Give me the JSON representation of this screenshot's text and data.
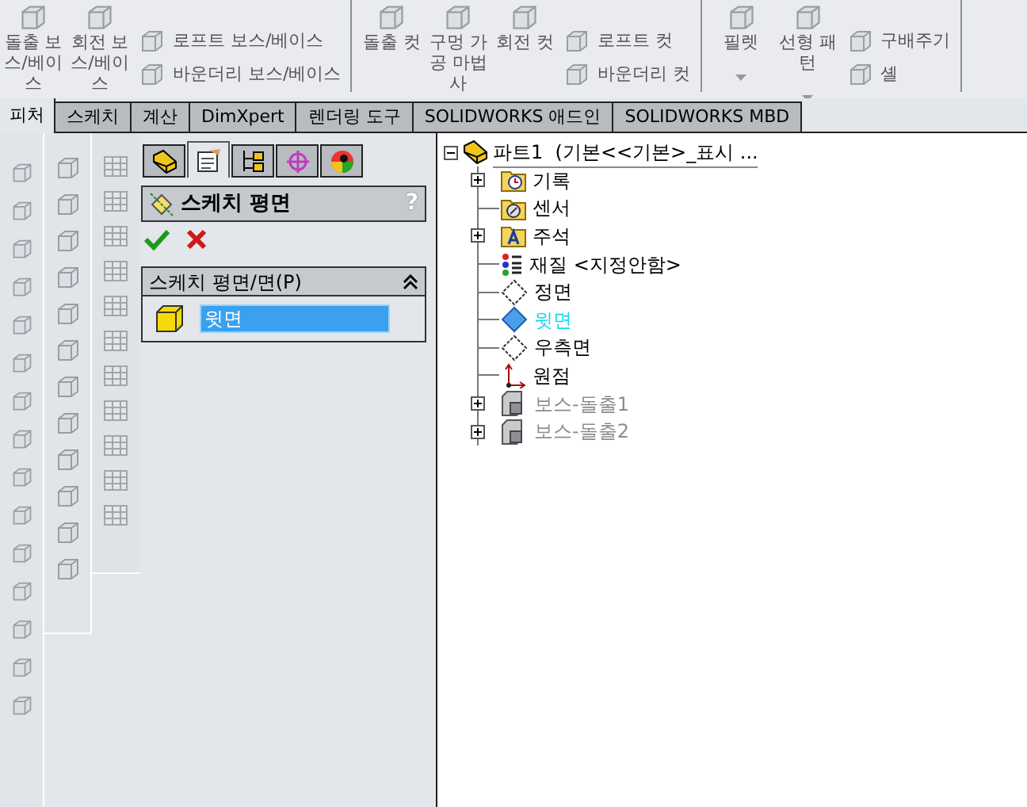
{
  "ribbon": {
    "groups": [
      {
        "large_buttons": [
          {
            "label": "돌출 보스/베이스",
            "dropdown": false
          },
          {
            "label": "회전 보스/베이스",
            "dropdown": false
          }
        ],
        "small_buttons": [
          "로프트 보스/베이스",
          "바운더리 보스/베이스"
        ]
      },
      {
        "large_buttons": [
          {
            "label": "돌출 컷",
            "dropdown": false
          },
          {
            "label": "구멍 가공 마법사",
            "dropdown": false
          },
          {
            "label": "회전 컷",
            "dropdown": false
          }
        ],
        "small_buttons": [
          "로프트 컷",
          "바운더리 컷"
        ]
      },
      {
        "large_buttons": [
          {
            "label": "필렛",
            "dropdown": true
          },
          {
            "label": "선형 패턴",
            "dropdown": true
          }
        ],
        "small_buttons": [
          "구배주기",
          "셸"
        ]
      }
    ]
  },
  "tabs": [
    {
      "label": "피처",
      "selected": true
    },
    {
      "label": "스케치",
      "selected": false
    },
    {
      "label": "계산",
      "selected": false
    },
    {
      "label": "DimXpert",
      "selected": false
    },
    {
      "label": "렌더링 도구",
      "selected": false
    },
    {
      "label": "SOLIDWORKS 애드인",
      "selected": false
    },
    {
      "label": "SOLIDWORKS MBD",
      "selected": false
    }
  ],
  "property_manager": {
    "tabs": [
      {
        "kind": "feature",
        "selected": false
      },
      {
        "kind": "property",
        "selected": true
      },
      {
        "kind": "config",
        "selected": false
      },
      {
        "kind": "dimxpert",
        "selected": false
      },
      {
        "kind": "display",
        "selected": false
      }
    ],
    "title": "스케치 평면",
    "help": "?",
    "group": {
      "title": "스케치 평면/면(P)",
      "expanded": true,
      "selection": "윗면"
    }
  },
  "tree": {
    "root": {
      "label": "파트1  (기본<<기본>_표시 ...",
      "expanded": true,
      "children": [
        {
          "label": "기록",
          "kind": "history",
          "expandable": true,
          "highlighted": false,
          "greyed": false
        },
        {
          "label": "센서",
          "kind": "sensor",
          "expandable": false,
          "highlighted": false,
          "greyed": false
        },
        {
          "label": "주석",
          "kind": "annotation",
          "expandable": true,
          "highlighted": false,
          "greyed": false
        },
        {
          "label": "재질 <지정안함>",
          "kind": "material",
          "expandable": false,
          "highlighted": false,
          "greyed": false
        },
        {
          "label": "정면",
          "kind": "plane",
          "expandable": false,
          "highlighted": false,
          "greyed": false
        },
        {
          "label": "윗면",
          "kind": "plane",
          "expandable": false,
          "highlighted": true,
          "greyed": false
        },
        {
          "label": "우측면",
          "kind": "plane",
          "expandable": false,
          "highlighted": false,
          "greyed": false
        },
        {
          "label": "원점",
          "kind": "origin",
          "expandable": false,
          "highlighted": false,
          "greyed": false
        },
        {
          "label": "보스-돌출1",
          "kind": "feature",
          "expandable": true,
          "highlighted": false,
          "greyed": true
        },
        {
          "label": "보스-돌출2",
          "kind": "feature",
          "expandable": true,
          "highlighted": false,
          "greyed": true
        }
      ]
    }
  }
}
